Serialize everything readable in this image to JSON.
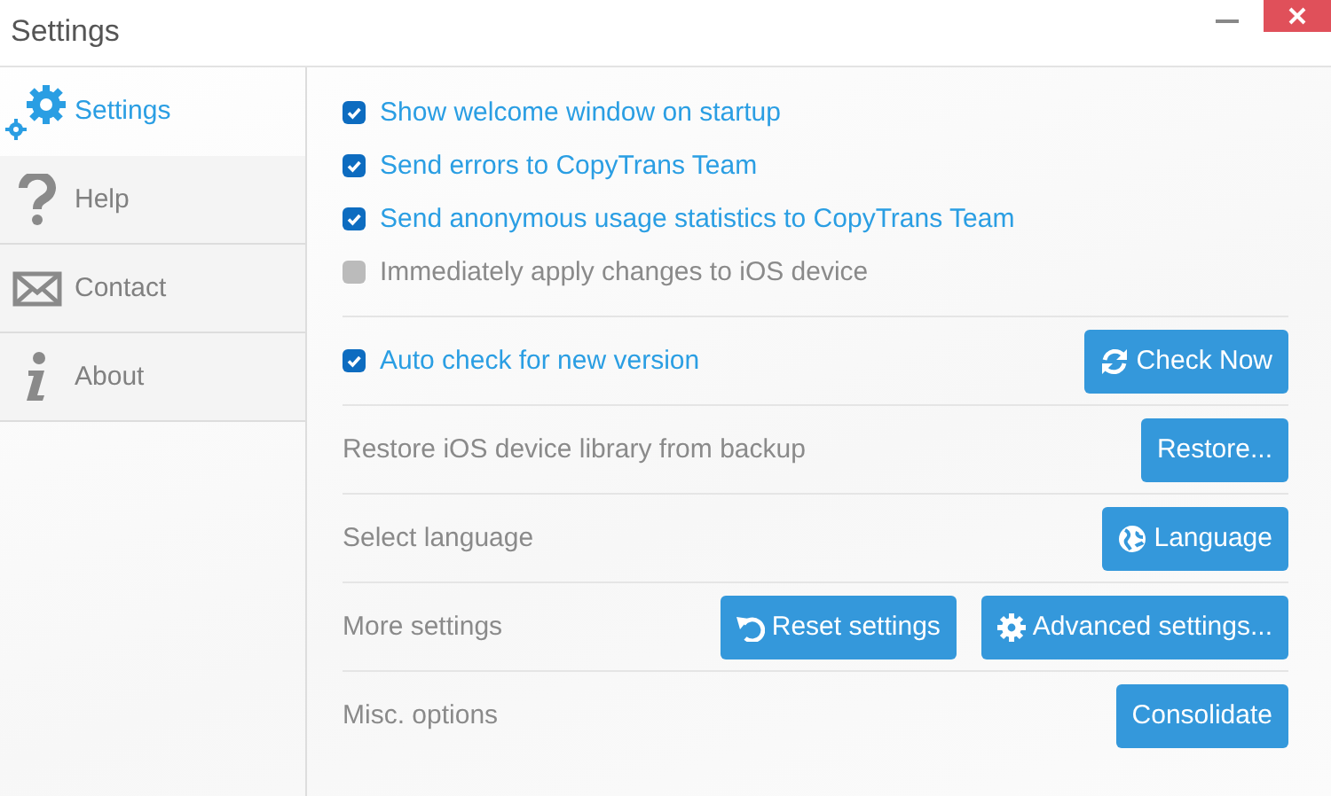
{
  "window": {
    "title": "Settings"
  },
  "sidebar": {
    "items": [
      {
        "label": "Settings",
        "selected": true
      },
      {
        "label": "Help",
        "selected": false
      },
      {
        "label": "Contact",
        "selected": false
      },
      {
        "label": "About",
        "selected": false
      }
    ]
  },
  "options": [
    {
      "label": "Show welcome window on startup",
      "checked": true
    },
    {
      "label": "Send errors to CopyTrans Team",
      "checked": true
    },
    {
      "label": "Send anonymous usage statistics to CopyTrans Team",
      "checked": true
    },
    {
      "label": "Immediately apply changes to iOS device",
      "checked": false
    }
  ],
  "rows": [
    {
      "kind": "checkbox",
      "label": "Auto check for new version",
      "checked": true,
      "buttons": [
        {
          "label": "Check Now"
        }
      ]
    },
    {
      "kind": "text",
      "label": "Restore iOS device library from backup",
      "buttons": [
        {
          "label": "Restore..."
        }
      ]
    },
    {
      "kind": "text",
      "label": "Select language",
      "buttons": [
        {
          "label": "Language"
        }
      ]
    },
    {
      "kind": "text",
      "label": "More settings",
      "buttons": [
        {
          "label": "Reset settings"
        },
        {
          "label": "Advanced settings..."
        }
      ]
    },
    {
      "kind": "text",
      "label": "Misc. options",
      "buttons": [
        {
          "label": "Consolidate"
        }
      ]
    }
  ]
}
